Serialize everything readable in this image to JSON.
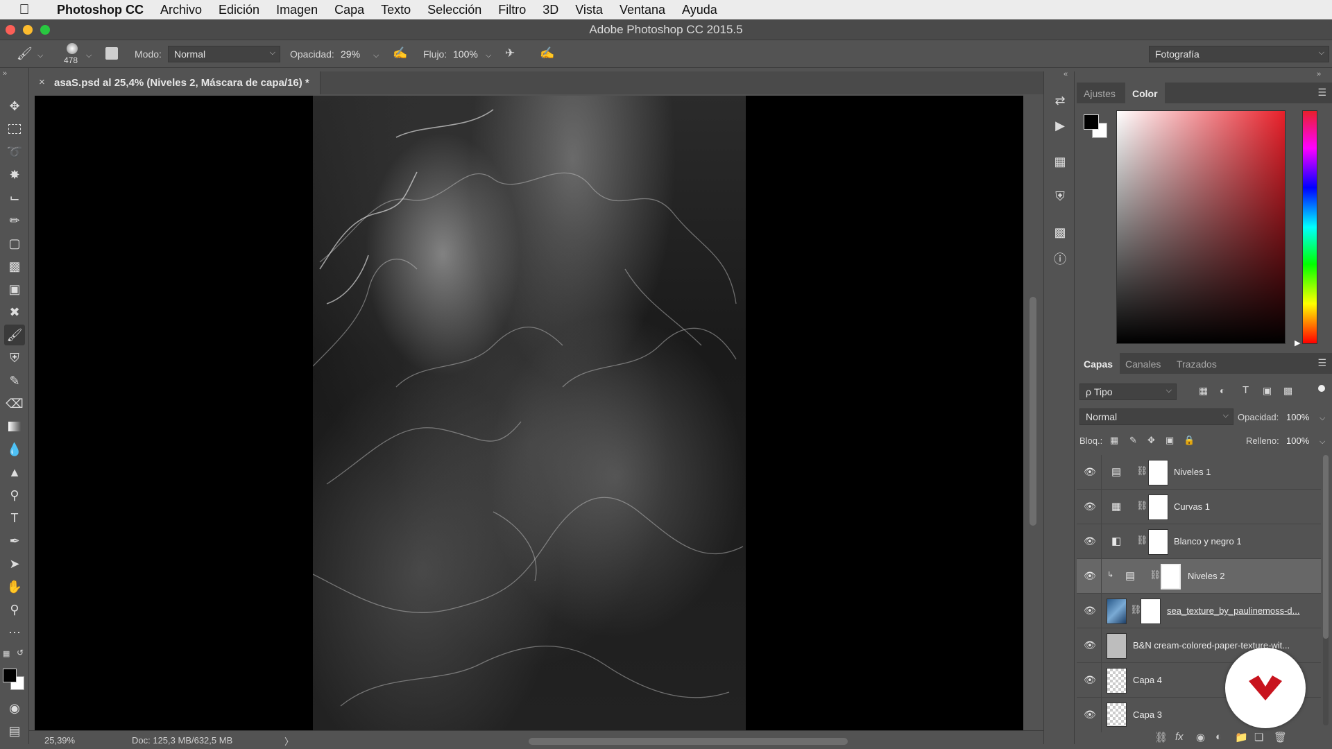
{
  "menubar": {
    "apple": "",
    "app_name": "Photoshop CC",
    "items": [
      "Archivo",
      "Edición",
      "Imagen",
      "Capa",
      "Texto",
      "Selección",
      "Filtro",
      "3D",
      "Vista",
      "Ventana",
      "Ayuda"
    ]
  },
  "window": {
    "title": "Adobe Photoshop CC 2015.5"
  },
  "options": {
    "brush_size": "478",
    "mode_label": "Modo:",
    "mode_value": "Normal",
    "opacity_label": "Opacidad:",
    "opacity_value": "29%",
    "flow_label": "Flujo:",
    "flow_value": "100%",
    "workspace": "Fotografía"
  },
  "document": {
    "tab_title": "asaS.psd al 25,4% (Niveles 2, Máscara de capa/16) *",
    "close": "×"
  },
  "status": {
    "zoom": "25,39%",
    "doc_info": "Doc: 125,3 MB/632,5 MB",
    "arrow": "〉"
  },
  "color_panel": {
    "tabs": [
      "Ajustes",
      "Color"
    ],
    "active_tab": "Color",
    "foreground": "#000000",
    "background": "#ffffff",
    "hue_color": "#e8202a"
  },
  "layers_panel": {
    "tabs": [
      "Capas",
      "Canales",
      "Trazados"
    ],
    "active_tab": "Capas",
    "filter_value": "ρ Tipo",
    "blend_mode": "Normal",
    "opacity_label": "Opacidad:",
    "opacity_value": "100%",
    "lock_label": "Bloq.:",
    "fill_label": "Relleno:",
    "fill_value": "100%",
    "layers": [
      {
        "name": "Niveles 1",
        "kind": "levels",
        "selected": false
      },
      {
        "name": "Curvas 1",
        "kind": "curves",
        "selected": false
      },
      {
        "name": "Blanco y negro 1",
        "kind": "bw",
        "selected": false
      },
      {
        "name": "Niveles 2",
        "kind": "levels",
        "selected": true
      },
      {
        "name": "sea_texture_by_paulinemoss-d...",
        "kind": "image",
        "selected": false
      },
      {
        "name": "B&N cream-colored-paper-texture-wit...",
        "kind": "smart",
        "selected": false
      },
      {
        "name": "Capa 4",
        "kind": "pixel",
        "selected": false
      },
      {
        "name": "Capa 3",
        "kind": "pixel",
        "selected": false
      }
    ]
  },
  "watermark": {
    "brand_color": "#c8141e"
  }
}
